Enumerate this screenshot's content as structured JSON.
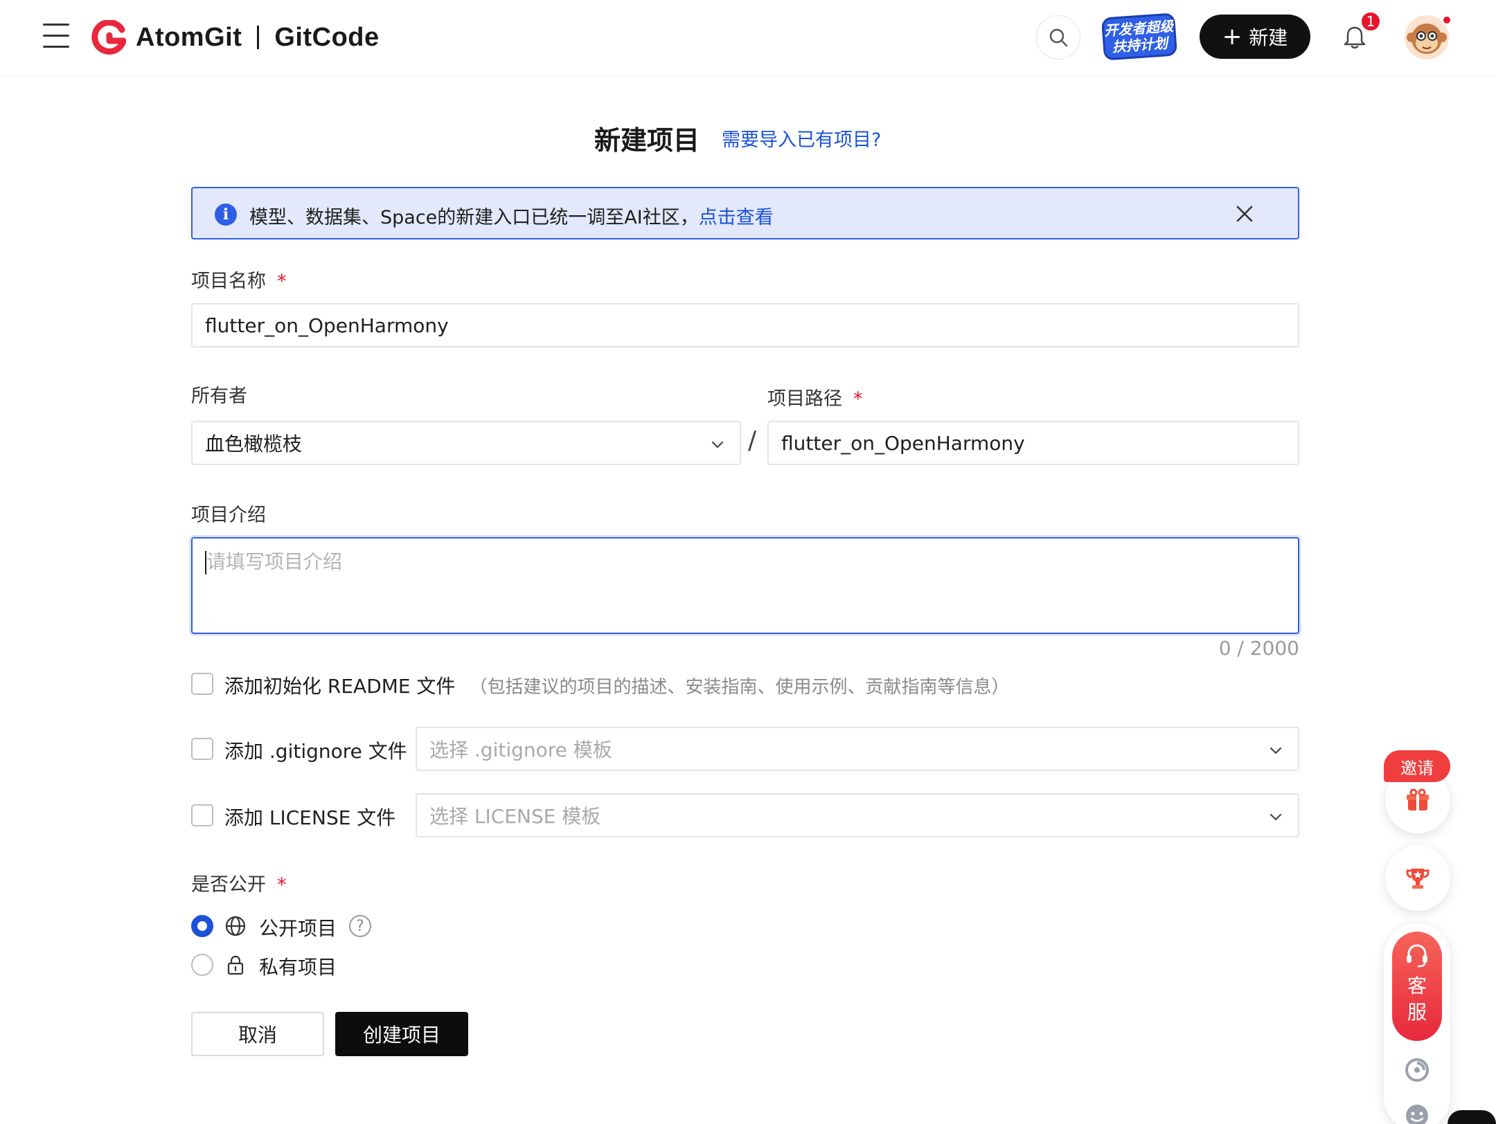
{
  "header": {
    "brand_left": "AtomGit",
    "brand_right": "GitCode",
    "promo_line1": "开发者超级",
    "promo_line2": "扶持计划",
    "new_button_label": "新建",
    "notification_count": "1"
  },
  "page": {
    "title": "新建项目",
    "import_link": "需要导入已有项目?"
  },
  "notice": {
    "text": "模型、数据集、Space的新建入口已统一调至AI社区，",
    "link": "点击查看"
  },
  "form": {
    "project_name_label": "项目名称",
    "required_mark": "*",
    "project_name_value": "flutter_on_OpenHarmony",
    "owner_label": "所有者",
    "owner_value": "血色橄榄枝",
    "path_separator": "/",
    "path_label": "项目路径",
    "path_value": "flutter_on_OpenHarmony",
    "intro_label": "项目介绍",
    "intro_placeholder": "请填写项目介绍",
    "intro_counter": "0 / 2000",
    "readme_label": "添加初始化 README 文件",
    "readme_hint": "（包括建议的项目的描述、安装指南、使用示例、贡献指南等信息）",
    "gitignore_label": "添加 .gitignore 文件",
    "gitignore_placeholder": "选择 .gitignore 模板",
    "license_label": "添加 LICENSE 文件",
    "license_placeholder": "选择 LICENSE 模板",
    "visibility_label": "是否公开",
    "public_label": "公开项目",
    "private_label": "私有项目",
    "help_glyph": "?",
    "selected_visibility": "public",
    "cancel_label": "取消",
    "create_label": "创建项目"
  },
  "floating": {
    "invite_label": "邀请",
    "customer_service_label": "客服"
  },
  "colors": {
    "accent": "#1b52d8",
    "notice_bg": "#e3e8fb",
    "required": "#e8152a",
    "brand_red": "#e8283c",
    "primary_button": "#0d0d0d"
  },
  "icons": {
    "menu": "menu-icon",
    "search": "search-icon",
    "bell": "bell-icon",
    "info": "info-icon",
    "close": "close-icon",
    "chevron": "chevron-down-icon",
    "globe": "globe-icon",
    "lock": "lock-icon",
    "help": "help-icon",
    "gift": "gift-icon",
    "trophy": "trophy-icon",
    "headset": "headset-icon"
  }
}
